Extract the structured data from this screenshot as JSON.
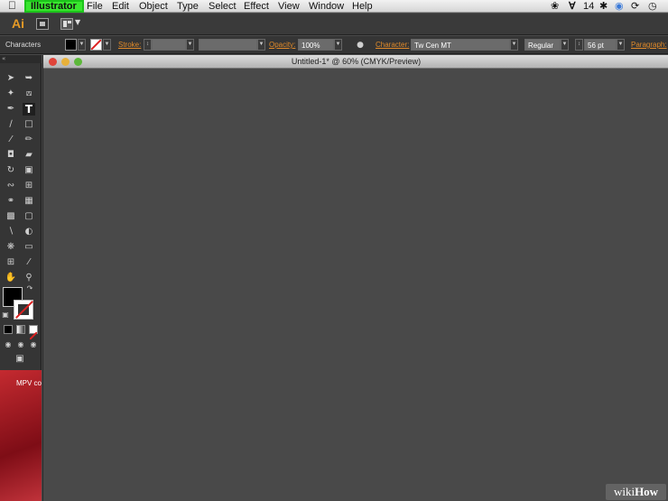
{
  "menubar": {
    "app_name": "Illustrator",
    "items": [
      "File",
      "Edit",
      "Object",
      "Type",
      "Select",
      "Effect",
      "View",
      "Window",
      "Help"
    ],
    "status_count": "14",
    "highlight_color": "#39e62e"
  },
  "appbar": {
    "logo": "Ai"
  },
  "control_panel": {
    "panel_label": "Characters",
    "stroke_label": "Stroke:",
    "opacity_label": "Opacity:",
    "opacity_value": "100%",
    "character_label": "Character:",
    "font_family": "Tw Cen MT",
    "font_style": "Regular",
    "font_size": "56 pt",
    "paragraph_label": "Paragraph:",
    "accent_color": "#e08a2a"
  },
  "toolbox": {
    "tools": [
      "selection-icon",
      "direct-selection-icon",
      "magic-wand-icon",
      "lasso-icon",
      "pen-icon",
      "type-icon",
      "line-icon",
      "rectangle-icon",
      "paintbrush-icon",
      "pencil-icon",
      "blob-brush-icon",
      "eraser-icon",
      "rotate-icon",
      "scale-icon",
      "warp-icon",
      "free-transform-icon",
      "shape-builder-icon",
      "perspective-grid-icon",
      "mesh-icon",
      "gradient-icon",
      "eyedropper-icon",
      "blend-icon",
      "symbol-sprayer-icon",
      "graph-icon",
      "artboard-icon",
      "slice-icon",
      "hand-icon",
      "zoom-icon"
    ],
    "active_tool": "type-icon"
  },
  "document": {
    "title": "Untitled-1* @ 60% (CMYK/Preview)"
  },
  "desktop_label": "MPV co",
  "watermark": {
    "part1": "wiki",
    "part2": "How"
  }
}
